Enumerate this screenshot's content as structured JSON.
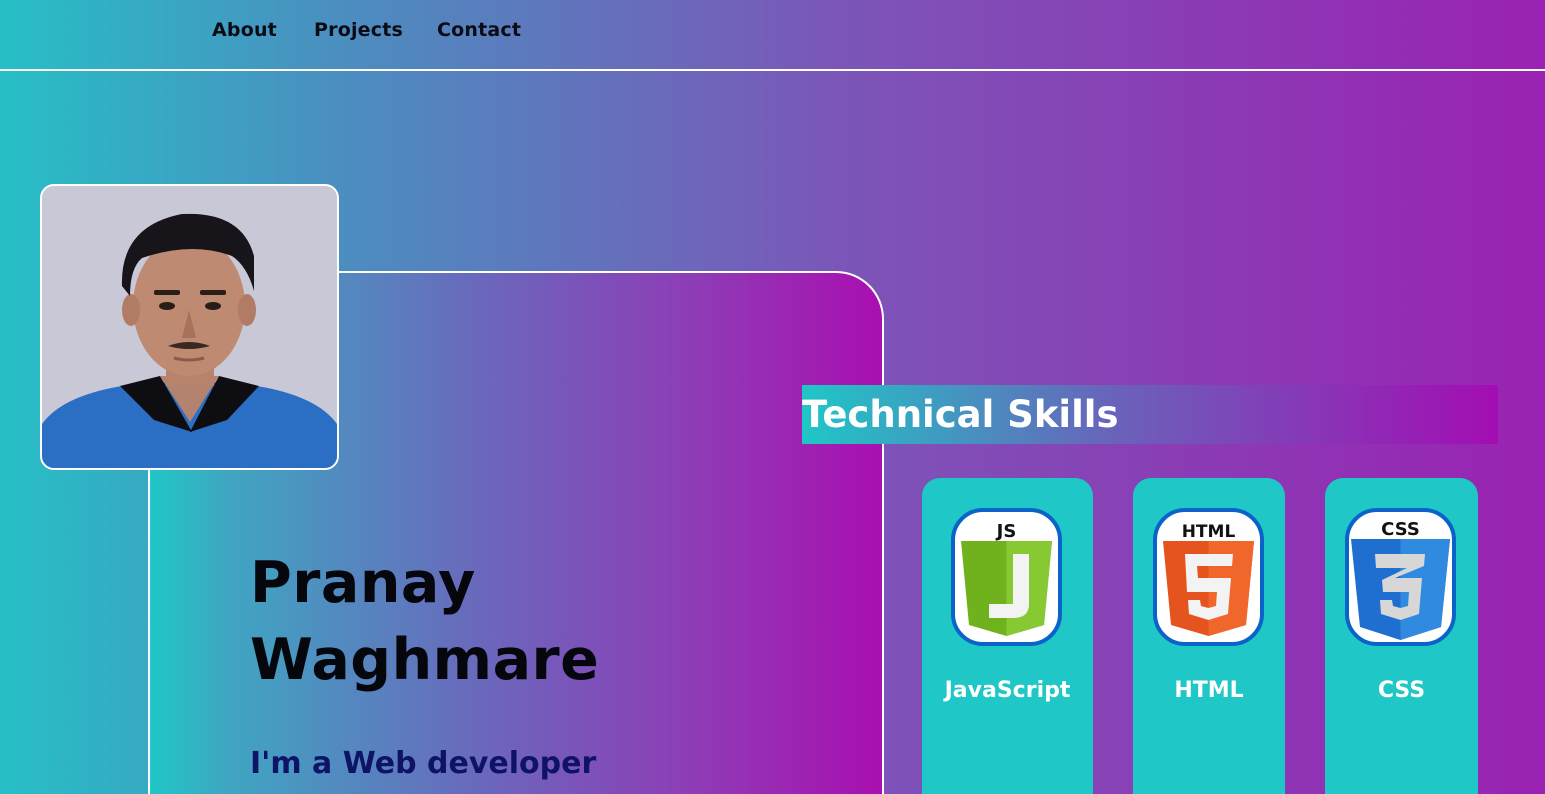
{
  "nav": {
    "links": [
      {
        "label": "About"
      },
      {
        "label": "Projects"
      },
      {
        "label": "Contact"
      }
    ]
  },
  "hero": {
    "first_name": "Pranay",
    "last_name": "Waghmare",
    "tagline": "I'm a Web developer",
    "photo_icon": "profile-photo"
  },
  "skills": {
    "heading": "Technical Skills",
    "items": [
      {
        "label": "JavaScript",
        "badge": "JS",
        "icon": "javascript-shield-icon",
        "color": "#6fb21d"
      },
      {
        "label": "HTML",
        "badge": "HTML",
        "icon": "html5-shield-icon",
        "color": "#e5531f"
      },
      {
        "label": "CSS",
        "badge": "CSS",
        "icon": "css3-shield-icon",
        "color": "#1f6fd0"
      }
    ]
  },
  "colors": {
    "teal": "#1fc7c6",
    "purple": "#a90fb0",
    "name_text": "#06060d",
    "tagline_text": "#0f1366"
  }
}
